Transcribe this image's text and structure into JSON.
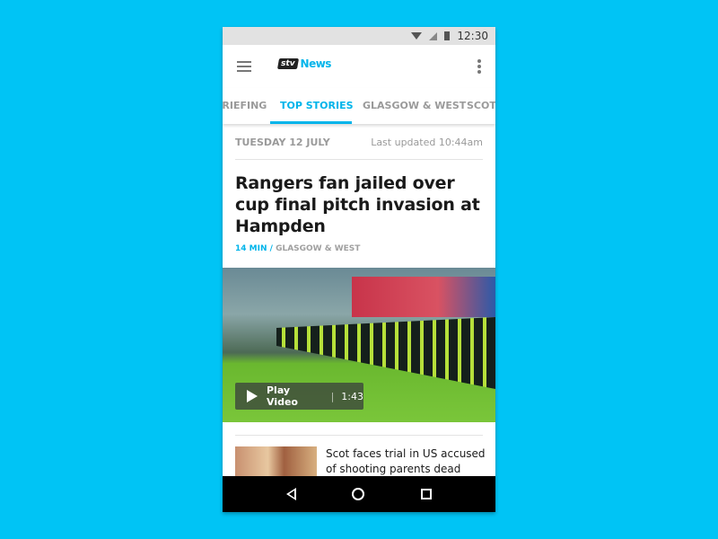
{
  "status_bar": {
    "time": "12:30",
    "icons": [
      "wifi-icon",
      "signal-icon",
      "battery-icon"
    ]
  },
  "app_bar": {
    "logo_brand": "stv",
    "logo_text": "News"
  },
  "tabs": [
    {
      "label": "BRIEFING"
    },
    {
      "label": "TOP STORIES",
      "active": true
    },
    {
      "label": "GLASGOW & WEST"
    },
    {
      "label": "SCOTLAND"
    }
  ],
  "tab_visible": [
    "RIEFING",
    "TOP STORIES",
    "GLASGOW & WEST",
    "SCOTL"
  ],
  "dateline": {
    "date": "TUESDAY 12 JULY",
    "updated": "Last updated 10:44am"
  },
  "lead": {
    "headline": "Rangers fan jailed over cup final pitch invasion at Hampden",
    "age": "14 MIN",
    "sep": "/",
    "section": "GLASGOW & WEST",
    "play_label": "Play Video",
    "sep2": "|",
    "duration": "1:43"
  },
  "stories": [
    {
      "headline": "Scot faces trial in US accused of shooting parents dead"
    }
  ],
  "colors": {
    "accent": "#00b4ea",
    "background": "#00c4f5"
  }
}
